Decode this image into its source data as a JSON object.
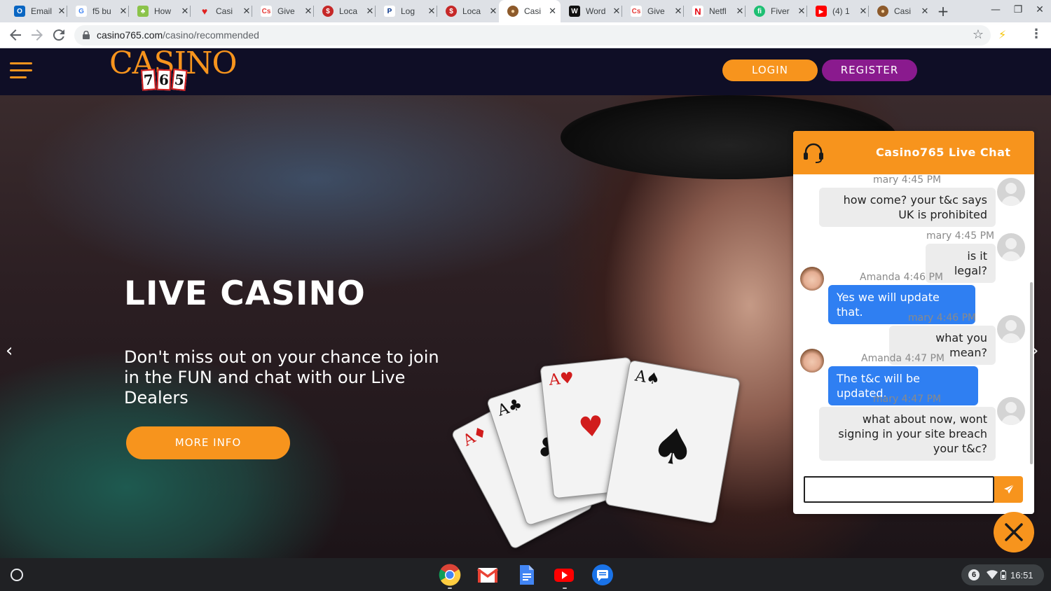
{
  "browser": {
    "tabs": [
      {
        "title": "Email",
        "favicon_color": "#0a66c2",
        "favicon_glyph": "O",
        "icon": "outlook-icon"
      },
      {
        "title": "f5 bu",
        "favicon_color": "#ffffff",
        "favicon_glyph": "G",
        "icon": "google-icon"
      },
      {
        "title": "How",
        "favicon_color": "#8bc34a",
        "favicon_glyph": "♣",
        "icon": "frog-icon"
      },
      {
        "title": "Casi",
        "favicon_color": "#e0211f",
        "favicon_glyph": "♥",
        "icon": "heart-icon"
      },
      {
        "title": "Give",
        "favicon_color": "#e53935",
        "favicon_glyph": "Cs",
        "icon": "casinos-icon"
      },
      {
        "title": "Loca",
        "favicon_color": "#c62828",
        "favicon_glyph": "$",
        "icon": "casino-chip-icon"
      },
      {
        "title": "Log",
        "favicon_color": "#003087",
        "favicon_glyph": "P",
        "icon": "paypal-icon"
      },
      {
        "title": "Loca",
        "favicon_color": "#c62828",
        "favicon_glyph": "$",
        "icon": "casino-chip-icon"
      },
      {
        "title": "Casi",
        "favicon_color": "#8d5a2b",
        "favicon_glyph": "●",
        "icon": "casino765-icon",
        "active": true
      },
      {
        "title": "Word",
        "favicon_color": "#111111",
        "favicon_glyph": "W",
        "icon": "word-icon"
      },
      {
        "title": "Give",
        "favicon_color": "#e53935",
        "favicon_glyph": "Cs",
        "icon": "casinos-icon"
      },
      {
        "title": "Netfl",
        "favicon_color": "#e50914",
        "favicon_glyph": "N",
        "icon": "netflix-icon"
      },
      {
        "title": "Fiver",
        "favicon_color": "#1dbf73",
        "favicon_glyph": "fi",
        "icon": "fiverr-icon"
      },
      {
        "title": "(4) 1",
        "favicon_color": "#ff0000",
        "favicon_glyph": "▶",
        "icon": "youtube-icon"
      },
      {
        "title": "Casi",
        "favicon_color": "#8d5a2b",
        "favicon_glyph": "●",
        "icon": "casino765-icon"
      }
    ],
    "new_tab_label": "+",
    "window_controls": {
      "minimize": "—",
      "restore": "❐",
      "close": "✕"
    },
    "url": {
      "domain": "casino765.com",
      "path": "/casino/recommended"
    }
  },
  "site": {
    "logo": {
      "word": "CASINO",
      "digits": [
        "7",
        "6",
        "5"
      ]
    },
    "login_label": "LOGIN",
    "register_label": "REGISTER",
    "hero": {
      "title": "LIVE CASINO",
      "text": "Don't miss out on your chance to join in the FUN and chat with our Live Dealers",
      "button_label": "MORE INFO",
      "prev_glyph": "‹",
      "next_glyph": "›"
    }
  },
  "chat": {
    "title": "Casino765 Live Chat",
    "messages": [
      {
        "sender": "mary",
        "time": "4:45 PM",
        "text": "how come? your t&c says UK is prohibited",
        "direction": "out"
      },
      {
        "sender": "mary",
        "time": "4:45 PM",
        "text": "is it legal?",
        "direction": "out"
      },
      {
        "sender": "Amanda",
        "time": "4:46 PM",
        "text": "Yes we will update that.",
        "direction": "in"
      },
      {
        "sender": "mary",
        "time": "4:46 PM",
        "text": "what you mean?",
        "direction": "out"
      },
      {
        "sender": "Amanda",
        "time": "4:47 PM",
        "text": "The t&c will be updated.",
        "direction": "in"
      },
      {
        "sender": "mary",
        "time": "4:47 PM",
        "text": "what about now, wont signing in your site breach your t&c?",
        "direction": "out"
      }
    ],
    "input_value": ""
  },
  "shelf": {
    "apps": [
      "chrome-icon",
      "gmail-icon",
      "docs-icon",
      "youtube-icon",
      "messages-icon"
    ],
    "notification_count": "6",
    "time": "16:51"
  },
  "colors": {
    "accent": "#f7941d",
    "register": "#8a1a8e",
    "header_bg": "#0f0e26",
    "agent_bubble": "#2f7ff2"
  }
}
